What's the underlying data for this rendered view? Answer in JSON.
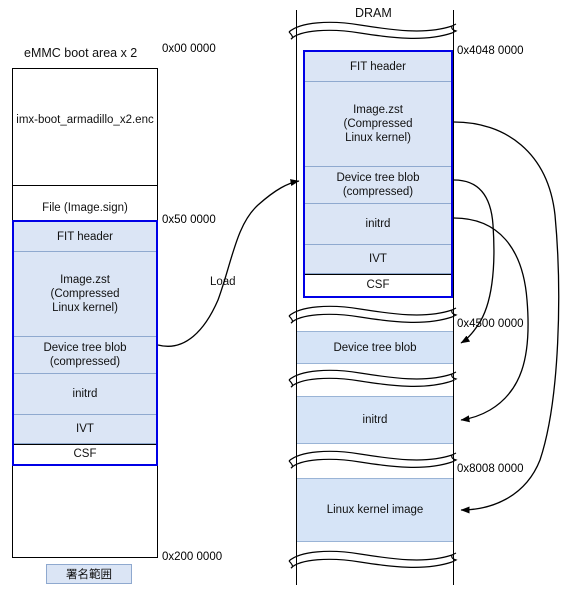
{
  "diagram": {
    "title_left": "eMMC boot area x 2",
    "title_right": "DRAM",
    "load_arrow_label": "Load",
    "legend_label": "署名範囲",
    "colors": {
      "signed_border": "#0000e6",
      "block_fill": "#dbe5f5",
      "dram_fill": "#d6e4f7",
      "outline": "#000000"
    }
  },
  "left_column": {
    "name": "eMMC boot area x 2",
    "sections": [
      {
        "label": "imx-boot_armadillo_x2.enc",
        "kind": "plain"
      },
      {
        "label": "File (Image.sign)",
        "kind": "plain"
      }
    ],
    "signed_image": {
      "rows": [
        {
          "label": "FIT header",
          "kind": "filled"
        },
        {
          "label": "Image.zst\n(Compressed\nLinux kernel)",
          "kind": "filled"
        },
        {
          "label": "Device tree blob\n(compressed)",
          "kind": "filled"
        },
        {
          "label": "initrd",
          "kind": "filled"
        },
        {
          "label": "IVT",
          "kind": "filled"
        },
        {
          "label": "CSF",
          "kind": "plain"
        }
      ]
    },
    "addresses": [
      {
        "text": "0x00 0000"
      },
      {
        "text": "0x50 0000"
      },
      {
        "text": "0x200 0000"
      }
    ]
  },
  "right_column": {
    "name": "DRAM",
    "signed_image": {
      "rows": [
        {
          "label": "FIT header",
          "kind": "filled"
        },
        {
          "label": "Image.zst\n(Compressed\nLinux kernel)",
          "kind": "filled"
        },
        {
          "label": "Device tree blob\n(compressed)",
          "kind": "filled"
        },
        {
          "label": "initrd",
          "kind": "filled"
        },
        {
          "label": "IVT",
          "kind": "filled"
        },
        {
          "label": "CSF",
          "kind": "plain"
        }
      ]
    },
    "regions": [
      {
        "label": "Device tree blob"
      },
      {
        "label": "initrd"
      },
      {
        "label": "Linux kernel image"
      }
    ],
    "addresses": [
      {
        "text": "0x4048 0000"
      },
      {
        "text": "0x4500 0000"
      },
      {
        "text": "0x8008 0000"
      }
    ]
  }
}
